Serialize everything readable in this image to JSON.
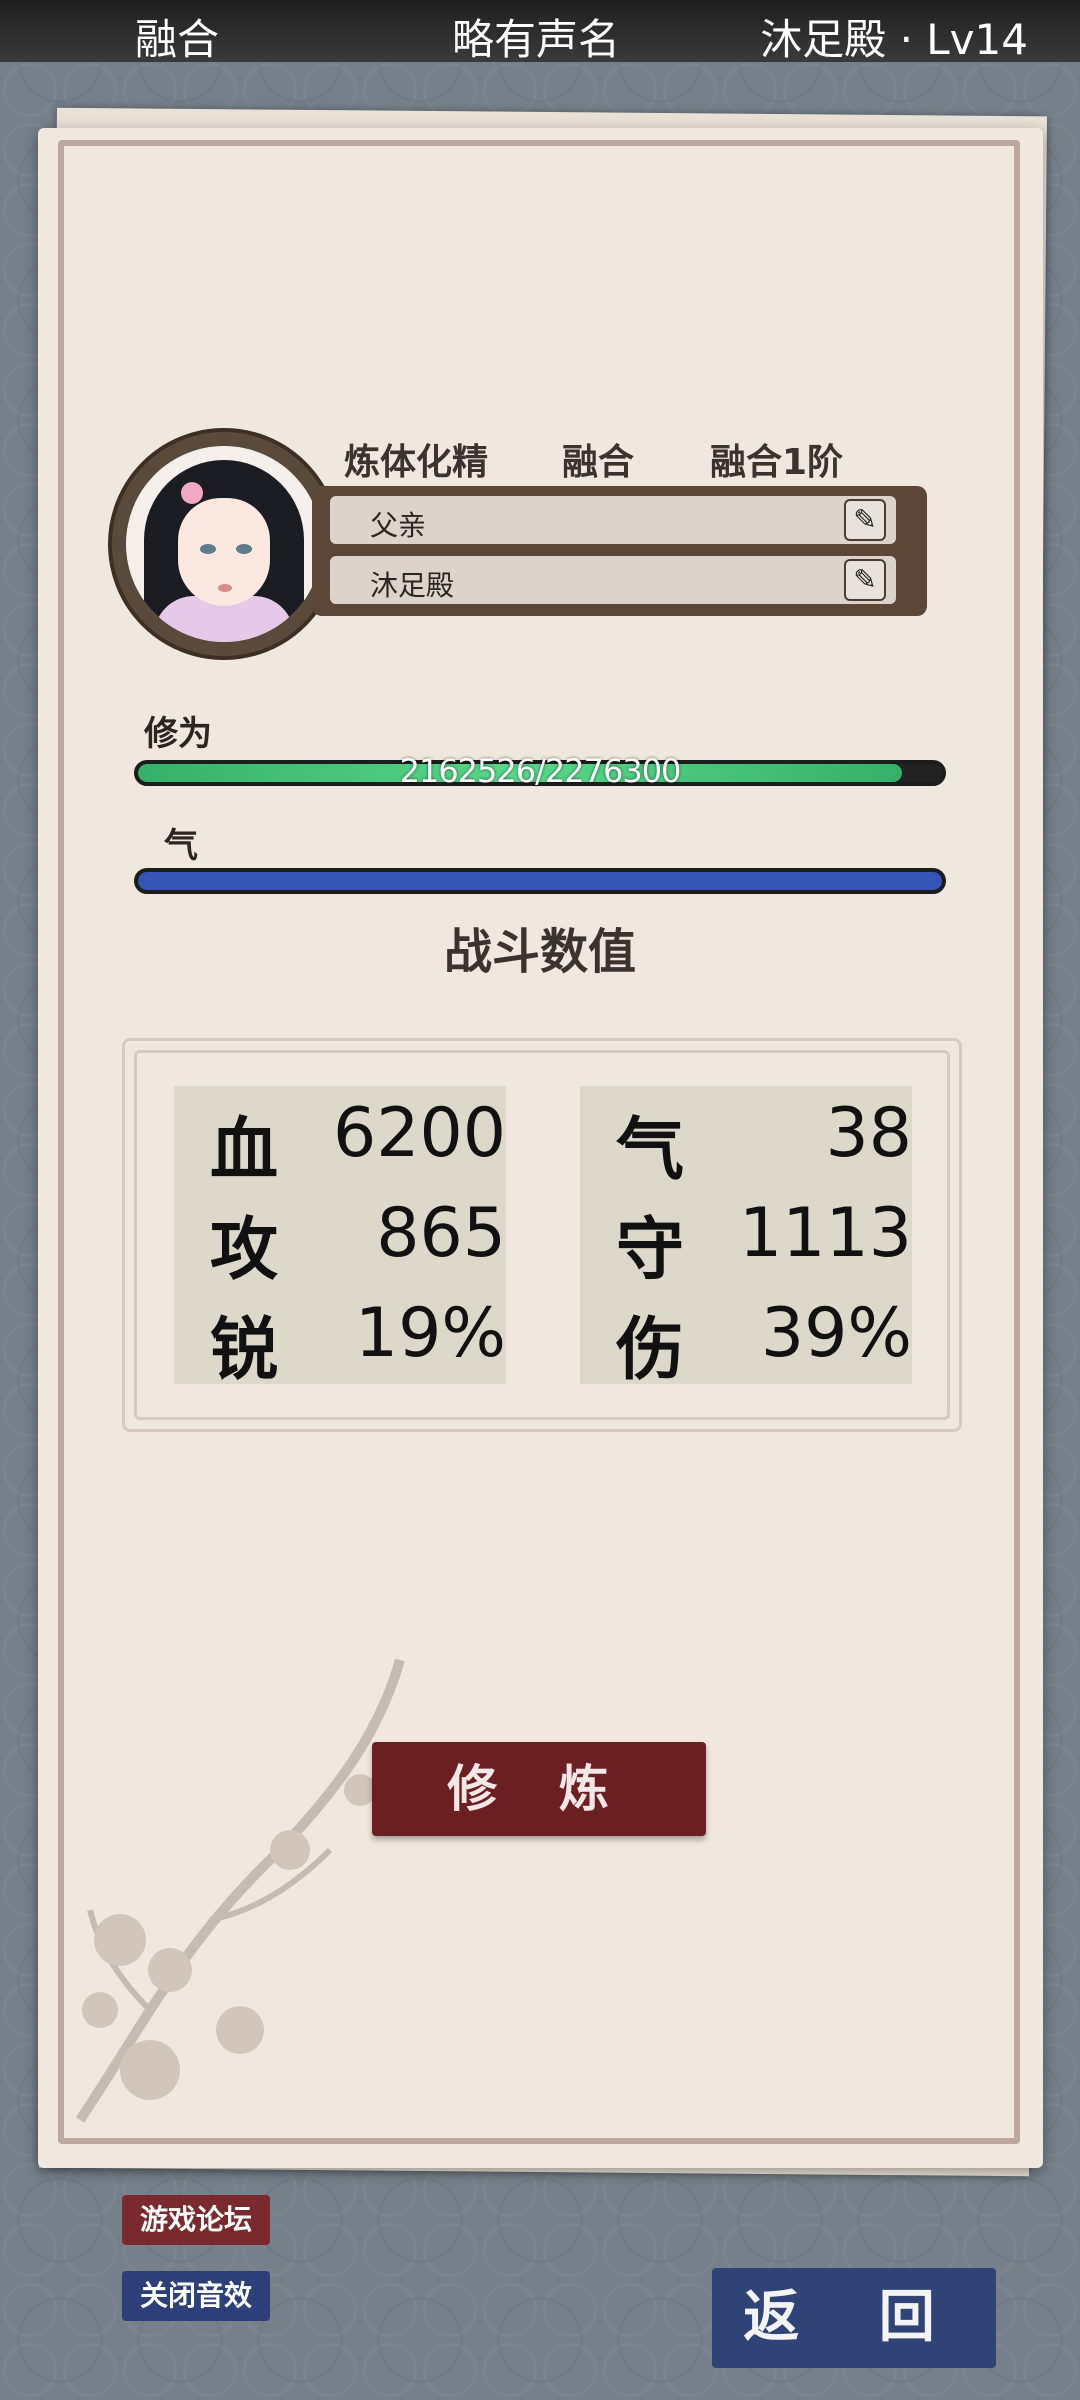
{
  "topbar": {
    "left": "融合",
    "middle": "略有声名",
    "right": "沐足殿 · Lv14"
  },
  "profile": {
    "tags": [
      "炼体化精",
      "融合",
      "融合1阶"
    ],
    "title_row": "父亲",
    "sect_row": "沐足殿",
    "edit_icon": "pencil-icon"
  },
  "cultivation": {
    "label": "修为",
    "current": 2162526,
    "max": 2276300,
    "text": "2162526/2276300",
    "fill": 0.95
  },
  "qi": {
    "label": "气",
    "fill": 1.0
  },
  "stats": {
    "title": "战斗数值",
    "left": [
      {
        "key": "血",
        "value": "6200"
      },
      {
        "key": "攻",
        "value": "865"
      },
      {
        "key": "锐",
        "value": "19%"
      }
    ],
    "right": [
      {
        "key": "气",
        "value": "38"
      },
      {
        "key": "守",
        "value": "1113"
      },
      {
        "key": "伤",
        "value": "39%"
      }
    ]
  },
  "buttons": {
    "train": "修 炼",
    "forum": "游戏论坛",
    "mute": "关闭音效",
    "back": "返 回"
  },
  "colors": {
    "train": "#6b1f22",
    "back": "#2f4377",
    "xiuwei_bar": "#35b06a",
    "qi_bar": "#3754b7"
  }
}
